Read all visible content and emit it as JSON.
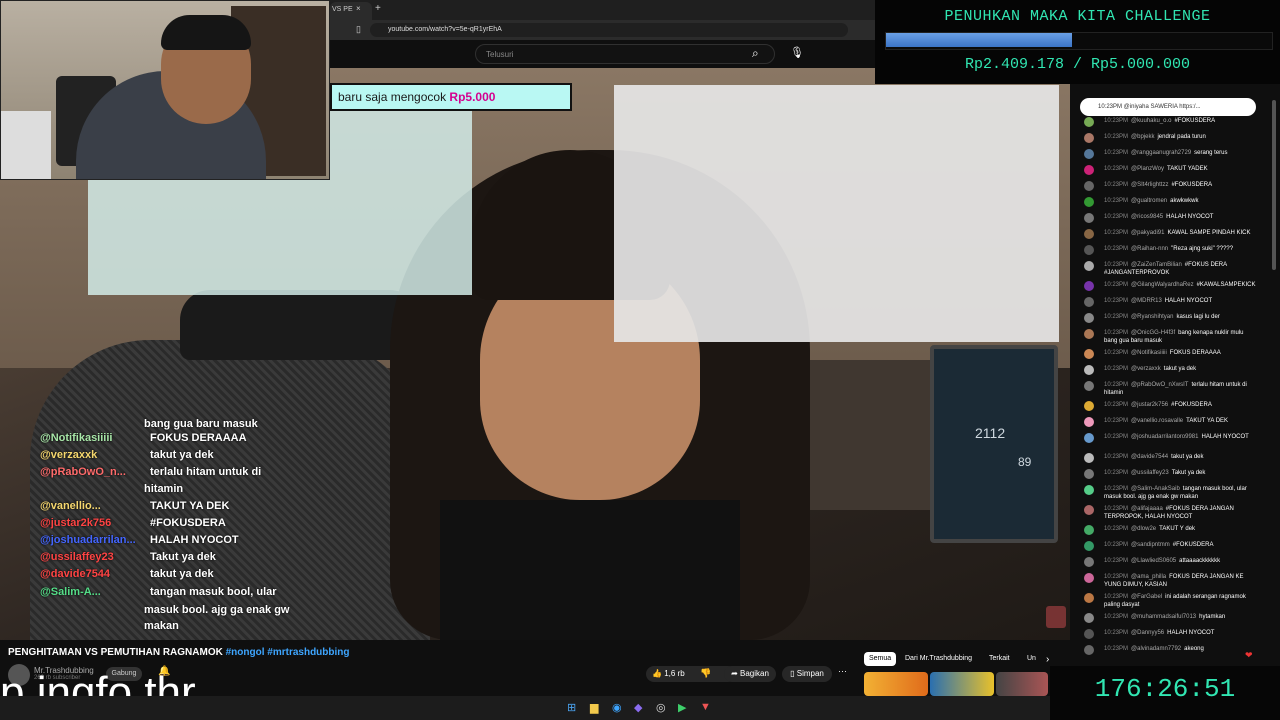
{
  "browser": {
    "tab_label": "VS PE",
    "close_icon": "×",
    "new_tab_icon": "+",
    "url": "youtube.com/watch?v=5e-qR1yrEhA"
  },
  "youtube": {
    "search_placeholder": "Telusuri",
    "video_title": "PENGHITAMAN VS PEMUTIHAN RAGNAMOK",
    "hashtags": "#nongol #mrtrashdubbing",
    "channel_name": "Mr.Trashdubbing",
    "subscribers": "260 rb subscriber",
    "join_label": "Gabung",
    "like_count": "1,6 rb",
    "share_label": "Bagikan",
    "save_label": "Simpan",
    "more_label": "···",
    "chips": [
      "Semua",
      "Dari Mr.Trashdubbing",
      "Terkait",
      "Un"
    ]
  },
  "donation_banner": {
    "text": "baru saja mengocok",
    "amount": "Rp5.000"
  },
  "video_chat": [
    {
      "user": "",
      "text": "bang gua baru masuk",
      "color": "#ffffff"
    },
    {
      "user": "@Notifikasiiiii",
      "text": "FOKUS DERAAAA",
      "color": "#a8e6a8"
    },
    {
      "user": "@verzaxxk",
      "text": "takut ya dek",
      "color": "#f5d76e"
    },
    {
      "user": "@pRabOwO_n...",
      "text": "terlalu hitam untuk di",
      "color": "#ff6b6b"
    },
    {
      "user": "",
      "text": "hitamin",
      "color": "#ffffff"
    },
    {
      "user": "@vanellio...",
      "text": "TAKUT YA DEK",
      "color": "#f5d76e"
    },
    {
      "user": "@justar2k756",
      "text": "#FOKUSDERA",
      "color": "#ff4444"
    },
    {
      "user": "@joshuadarrilan...",
      "text": "HALAH NYOCOT",
      "color": "#4466ff"
    },
    {
      "user": "@ussilaffey23",
      "text": "Takut ya dek",
      "color": "#ff4444"
    },
    {
      "user": "@davide7544",
      "text": "takut ya dek",
      "color": "#ff4444"
    },
    {
      "user": "@Salim-A...",
      "text": "tangan masuk bool, ular",
      "color": "#55dd88"
    },
    {
      "user": "",
      "text": "masuk bool. ajg ga enak gw",
      "color": "#ffffff"
    },
    {
      "user": "",
      "text": "makan",
      "color": "#ffffff"
    }
  ],
  "caption": "p ingfo thr",
  "challenge": {
    "title": "PENUHKAN MAKA KITA CHALLENGE",
    "amount_text": "Rp2.409.178 / Rp5.000.000",
    "current": 2409178,
    "target": 5000000
  },
  "pinned_message": "10:23PM  @iniyaha  SAWERIA  https:/...",
  "chat": [
    {
      "time": "10:23PM",
      "user": "@kuuhaku_o.o",
      "text": "#FOKUSDERA",
      "color": "#7a5"
    },
    {
      "time": "10:23PM",
      "user": "@bpjekk",
      "text": "jendral pada turun",
      "color": "#a76"
    },
    {
      "time": "10:23PM",
      "user": "@ranggaanugrah2729",
      "text": "serang terus",
      "color": "#579"
    },
    {
      "time": "10:23PM",
      "user": "@PlanzWoy",
      "text": "TAKUT YADEK",
      "color": "#c27"
    },
    {
      "time": "10:23PM",
      "user": "@SIt4rlighttzz",
      "text": "#FOKUSDERA",
      "color": "#666"
    },
    {
      "time": "10:23PM",
      "user": "@gualtromen",
      "text": "akwkwkwk",
      "color": "#393"
    },
    {
      "time": "10:23PM",
      "user": "@ricos9845",
      "text": "HALAH NYOCOT",
      "color": "#777"
    },
    {
      "time": "10:23PM",
      "user": "@pakyadi91",
      "text": "KAWAL SAMPE PINDAH KICK",
      "color": "#864"
    },
    {
      "time": "10:23PM",
      "user": "@Raihan-nnn",
      "text": "\"Reza ajng suki\" ?????",
      "color": "#555"
    },
    {
      "time": "10:23PM",
      "user": "@ZaiZenTamBilian",
      "text": "#FOKUS DERA #JANGANTERPROVOK",
      "color": "#aaa"
    },
    {
      "time": "10:23PM",
      "user": "@GilangWalyardhaRez",
      "text": "#KAWALSAMPEKICK",
      "color": "#73a"
    },
    {
      "time": "10:23PM",
      "user": "@MDRR13",
      "text": "HALAH NYOCOT",
      "color": "#666"
    },
    {
      "time": "10:23PM",
      "user": "@Ryanshihtyan",
      "text": "kasus lagi lu der",
      "color": "#888"
    },
    {
      "time": "10:23PM",
      "user": "@OnicGG-H4f3f",
      "text": "bang kenapa nuklir mulu bang gua baru masuk",
      "color": "#a75"
    },
    {
      "time": "10:23PM",
      "user": "@Notifikasiiiii",
      "text": "FOKUS DERAAAA",
      "color": "#c85"
    },
    {
      "time": "10:23PM",
      "user": "@verzaxxk",
      "text": "takut ya dek",
      "color": "#bbb"
    },
    {
      "time": "10:23PM",
      "user": "@pRabOwO_nXwsIT",
      "text": "terlalu hitam untuk di hitamin",
      "color": "#777"
    },
    {
      "time": "10:23PM",
      "user": "@justar2k756",
      "text": "#FOKUSDERA",
      "color": "#da3"
    },
    {
      "time": "10:23PM",
      "user": "@vanellio.rosavalle",
      "text": "TAKUT YA DEK",
      "color": "#e9b"
    },
    {
      "time": "10:23PM",
      "user": "@joshuadarrilantoro9981",
      "text": "HALAH NYOCOT",
      "color": "#69c"
    },
    {
      "time": "10:23PM",
      "user": "@davide7544",
      "text": "takut ya dek",
      "color": "#bbb"
    },
    {
      "time": "10:23PM",
      "user": "@ussilaffey23",
      "text": "Takut ya dek",
      "color": "#777"
    },
    {
      "time": "10:23PM",
      "user": "@Salim-AnakSaib",
      "text": "tangan masuk bool, ular masuk bool. ajg ga enak gw makan",
      "color": "#5c8"
    },
    {
      "time": "10:23PM",
      "user": "@alifajaaaa",
      "text": "#FOKUS DERA JANGAN TERPROPOK, HALAH NYOCOT",
      "color": "#a66"
    },
    {
      "time": "10:23PM",
      "user": "@dlow2e",
      "text": "TAKUT Y dek",
      "color": "#4a6"
    },
    {
      "time": "10:23PM",
      "user": "@sandipntmm",
      "text": "#FOKUSDERA",
      "color": "#396"
    },
    {
      "time": "10:23PM",
      "user": "@LlawliedS0605",
      "text": "attaaaackkkkkk",
      "color": "#777"
    },
    {
      "time": "10:23PM",
      "user": "@ama_philla",
      "text": "FOKUS DERA JANGAN KE YUNG DIMUY, KASIAN",
      "color": "#c69"
    },
    {
      "time": "10:23PM",
      "user": "@FarGabel",
      "text": "ini adalah serangan ragnamok paling dasyat",
      "color": "#b74"
    },
    {
      "time": "10:23PM",
      "user": "@muhammadsaiful7013",
      "text": "hytamkan",
      "color": "#888"
    },
    {
      "time": "10:23PM",
      "user": "@Dannyy56",
      "text": "HALAH NYOCOT",
      "color": "#555"
    },
    {
      "time": "10:23PM",
      "user": "@alvinadamn7792",
      "text": "akeong",
      "color": "#666"
    }
  ],
  "webcam_monitor": {
    "value1": "2112",
    "value2": "89"
  },
  "timer": "176:26:51",
  "colors": {
    "accent": "#31e6b2",
    "progress": "#3b74c6",
    "banner": "#b9f8f3"
  }
}
